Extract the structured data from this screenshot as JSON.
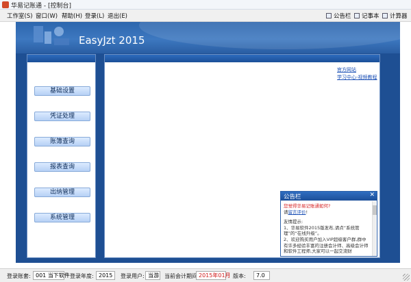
{
  "window": {
    "title": "华易记账通 - [控制台]"
  },
  "menu": [
    {
      "label": "工作室(S)"
    },
    {
      "label": "窗口(W)"
    },
    {
      "label": "帮助(H)"
    },
    {
      "label": "登录(L)"
    },
    {
      "label": "退出(E)"
    }
  ],
  "tools": [
    {
      "label": "公告栏",
      "icon": "bulletin-icon"
    },
    {
      "label": "记事本",
      "icon": "notepad-icon"
    },
    {
      "label": "计算器",
      "icon": "calculator-icon"
    }
  ],
  "banner": {
    "title": "EasyJzt 2015"
  },
  "nav": [
    {
      "label": "基础设置"
    },
    {
      "label": "凭证处理"
    },
    {
      "label": "账簿查询"
    },
    {
      "label": "报表查询"
    },
    {
      "label": "出纳管理"
    },
    {
      "label": "系统管理"
    }
  ],
  "main_links": {
    "official_site": "官方网站",
    "learning_center": "学习中心-视频教程"
  },
  "bulletin": {
    "title": "公告栏",
    "close": "✕",
    "question": "您觉得华易记账通如何?",
    "invite_prefix": "请",
    "invite_link": "留言评价",
    "invite_suffix": "!",
    "tips_title": "友情提示:",
    "tip1": "1、华易软件2015版发布,请点“系统管理”的“在线升级”。",
    "tip2": "2、欢迎购买用户加入VIP超级客户群,群中有许多经验丰富的注册会计师、高级会计师和软件工程师,大家可以一起交流财"
  },
  "status": {
    "account_label": "登录账套:",
    "account_value": "001 当下软件",
    "year_label": "登录年度:",
    "year_value": "2015",
    "user_label": "登录用户:",
    "user_value": "当游",
    "period_label": "当前会计期间:",
    "period_value": "2015年01月",
    "version_label": "版本:",
    "version_value": "7.0"
  },
  "colors": {
    "accent_red": "#d01818",
    "frame_blue": "#1e4f93",
    "link_blue": "#1a4fb5"
  }
}
